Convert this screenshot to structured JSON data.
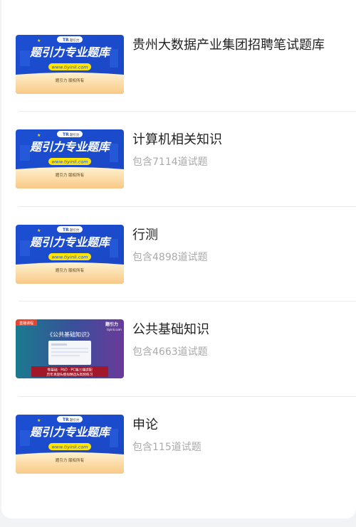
{
  "banner": {
    "title": "题引力专业题库",
    "url": "www.tiyinli.com",
    "footer": "题引力 版权所有",
    "badge": "题引力",
    "colors": {
      "blue": "#1e54d6",
      "yellow": "#ffe500",
      "cream": "#fde0a8"
    }
  },
  "course_banner": {
    "tag": "直播课程",
    "brand": "题引力",
    "domain": "tiyinli.com",
    "title": "《公共基础知识》",
    "line1": "零基础 · PAD · PC端三端适配",
    "line2": "历年真题&模拟精选&高频练习"
  },
  "items": [
    {
      "title": "贵州大数据产业集团招聘笔试题库",
      "meta": ""
    },
    {
      "title": "计算机相关知识",
      "meta": "包含7114道试题"
    },
    {
      "title": "行测",
      "meta": "包含4898道试题"
    },
    {
      "title": "公共基础知识",
      "meta": "包含4663道试题"
    },
    {
      "title": "申论",
      "meta": "包含115道试题"
    }
  ]
}
